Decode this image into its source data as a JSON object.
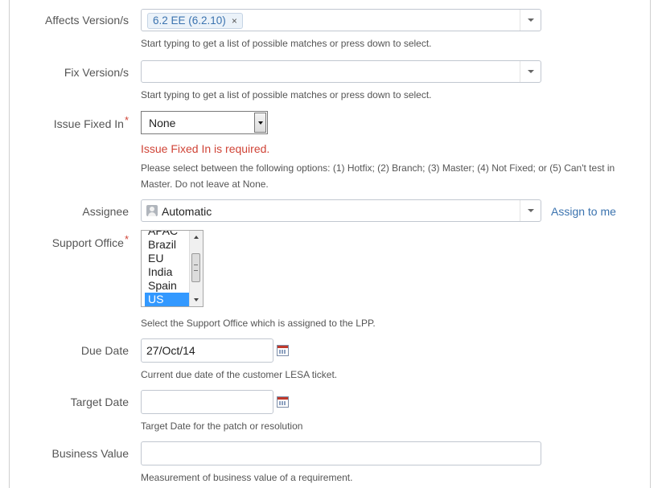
{
  "fields": {
    "affects_version": {
      "label": "Affects Version/s",
      "chip": "6.2 EE (6.2.10)",
      "chip_remove": "×",
      "help": "Start typing to get a list of possible matches or press down to select."
    },
    "fix_version": {
      "label": "Fix Version/s",
      "value": "",
      "help": "Start typing to get a list of possible matches or press down to select."
    },
    "issue_fixed_in": {
      "label": "Issue Fixed In",
      "required_mark": "*",
      "value": "None",
      "error": "Issue Fixed In is required.",
      "help_line1": "Please select between the following options: (1) Hotfix; (2) Branch; (3) Master; (4) Not Fixed; or (5) Can't test in",
      "help_line2": "Master. Do not leave at None."
    },
    "assignee": {
      "label": "Assignee",
      "value": "Automatic",
      "assign_to_me": "Assign to me"
    },
    "support_office": {
      "label": "Support Office",
      "required_mark": "*",
      "options": [
        "APAC",
        "Brazil",
        "EU",
        "India",
        "Spain",
        "US"
      ],
      "selected": "US",
      "help": "Select the Support Office which is assigned to the LPP."
    },
    "due_date": {
      "label": "Due Date",
      "value": "27/Oct/14",
      "help": "Current due date of the customer LESA ticket."
    },
    "target_date": {
      "label": "Target Date",
      "value": "",
      "help": "Target Date for the patch or resolution"
    },
    "business_value": {
      "label": "Business Value",
      "value": "",
      "help": "Measurement of business value of a requirement."
    }
  },
  "icons": {
    "dropdown": "chevron-down-icon",
    "avatar": "user-avatar-icon",
    "calendar": "calendar-icon"
  },
  "colors": {
    "link": "#3b73af",
    "error": "#d04437",
    "selection": "#3399ff"
  }
}
